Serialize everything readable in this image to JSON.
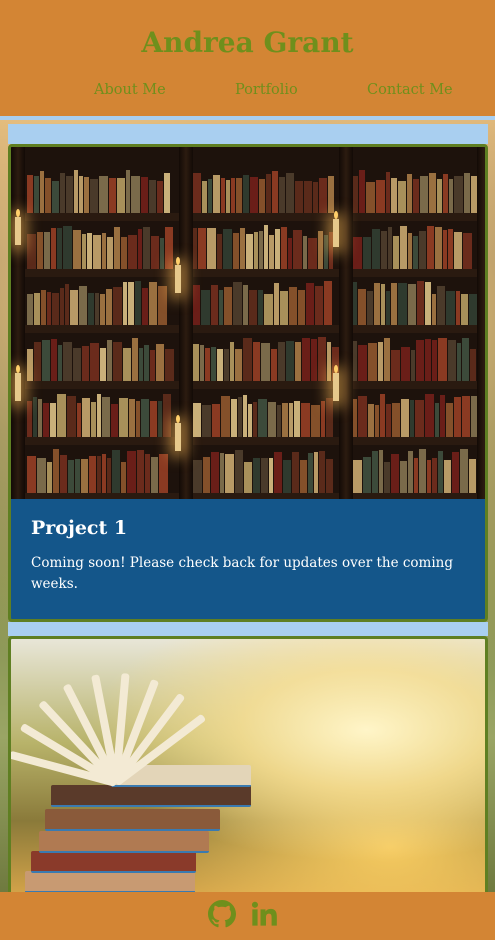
{
  "header": {
    "title": "Andrea Grant",
    "nav": [
      {
        "label": "About Me"
      },
      {
        "label": "Portfolio"
      },
      {
        "label": "Contact Me"
      }
    ]
  },
  "projects": [
    {
      "title": "Project 1",
      "description": "Coming soon! Please check back for updates over the coming weeks.",
      "image": "bookshelf-with-candles-image"
    },
    {
      "image": "open-book-stack-image"
    }
  ],
  "footer": {
    "icons": [
      "github-icon",
      "linkedin-icon"
    ]
  },
  "colors": {
    "header_bg": "#d38534",
    "title_text": "#6f8f1c",
    "card_bg": "#14568a",
    "card_border": "#5f7f22",
    "accent_strip": "#a9cff0"
  }
}
